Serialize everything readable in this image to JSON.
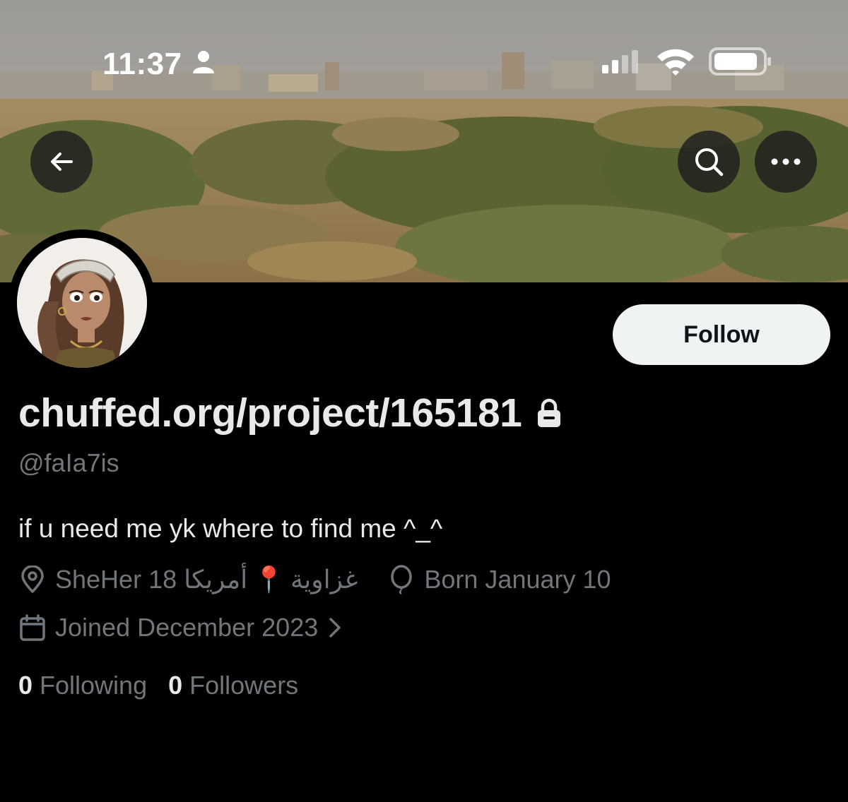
{
  "status_bar": {
    "time": "11:37"
  },
  "profile": {
    "display_name": "chuffed.org/project/165181",
    "handle": "@faIa7is",
    "bio": "if u need me yk where to find me ^_^",
    "location_part1": "SheHer 18 أمريكا",
    "location_pin": "📍",
    "location_part2": "غزاوية",
    "birthday": "Born January 10",
    "joined": "Joined December 2023",
    "following_count": "0",
    "following_label": "Following",
    "followers_count": "0",
    "followers_label": "Followers"
  },
  "actions": {
    "follow_label": "Follow"
  },
  "icons": {
    "back": "arrow-left-icon",
    "search": "search-icon",
    "more": "more-dots-icon",
    "lock": "lock-icon",
    "location": "location-pin-icon",
    "birthday": "balloon-icon",
    "joined": "calendar-icon"
  },
  "colors": {
    "background": "#000000",
    "primary_text": "#e7e9ea",
    "secondary_text": "#71767b",
    "follow_button_bg": "#eff3f4",
    "follow_button_text": "#0f1419"
  }
}
